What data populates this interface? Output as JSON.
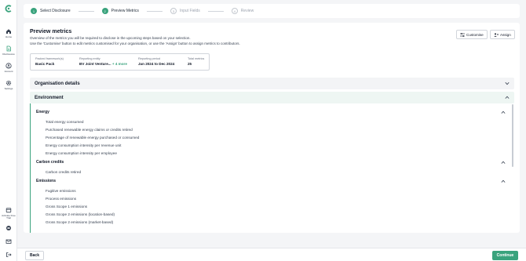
{
  "colors": {
    "accent": "#3aa37d",
    "text": "#111827",
    "muted": "#6b7280"
  },
  "sidebar": {
    "items": [
      {
        "label": "Home",
        "icon": "home-icon"
      },
      {
        "label": "Disclosures",
        "icon": "document-icon"
      },
      {
        "label": "Account",
        "icon": "account-icon"
      },
      {
        "label": "Settings",
        "icon": "gear-icon"
      },
      {
        "label": "Activate Free Trial",
        "icon": "calendar-icon"
      },
      {
        "label": "",
        "icon": "support-icon"
      },
      {
        "label": "",
        "icon": "mail-icon"
      },
      {
        "label": "",
        "icon": "logout-icon"
      }
    ]
  },
  "stepper": {
    "steps": [
      {
        "number": "1",
        "label": "Select Disclosure",
        "state": "done"
      },
      {
        "number": "2",
        "label": "Preview Metrics",
        "state": "current"
      },
      {
        "number": "3",
        "label": "Input Fields",
        "state": "upcoming"
      },
      {
        "number": "4",
        "label": "Review",
        "state": "upcoming"
      }
    ]
  },
  "main": {
    "title": "Preview metrics",
    "description_1": "Overview of the metrics you will be required to disclose in the upcoming steps based on your selection.",
    "description_2": "Use the 'Customise' button to edit metrics customised for your organisation, or use the 'Assign' button to assign metrics to contributors.",
    "customise_label": "Customise",
    "assign_label": "Assign",
    "summary": {
      "framework_label": "Packed framework(s)",
      "framework_value": "Basic Pack",
      "entity_label": "Reporting entity",
      "entity_value": "BV Joint Venture...",
      "entity_more": "+ 4 more",
      "period_label": "Reporting period",
      "period_value": "Jan 2024 to Dec 2024",
      "total_label": "Total metrics",
      "total_value": "25"
    },
    "sections": {
      "org_label": "Organisation details",
      "env_label": "Environment"
    },
    "groups": [
      {
        "name": "Energy",
        "metrics": [
          "Total energy consumed",
          "Purchased renewable energy claims or credits retired",
          "Percentage of renewable energy purchased or consumed",
          "Energy consumption intensity per revenue unit",
          "Energy consumption intensity per employee"
        ]
      },
      {
        "name": "Carbon credits",
        "metrics": [
          "Carbon credits retired"
        ]
      },
      {
        "name": "Emissions",
        "metrics": [
          "Fugitive emissions",
          "Process emissions",
          "Gross Scope 1 emissions",
          "Gross Scope 2 emissions (location-based)",
          "Gross Scope 2 emissions (market-based)"
        ]
      }
    ]
  },
  "footer": {
    "back_label": "Back",
    "continue_label": "Continue"
  }
}
